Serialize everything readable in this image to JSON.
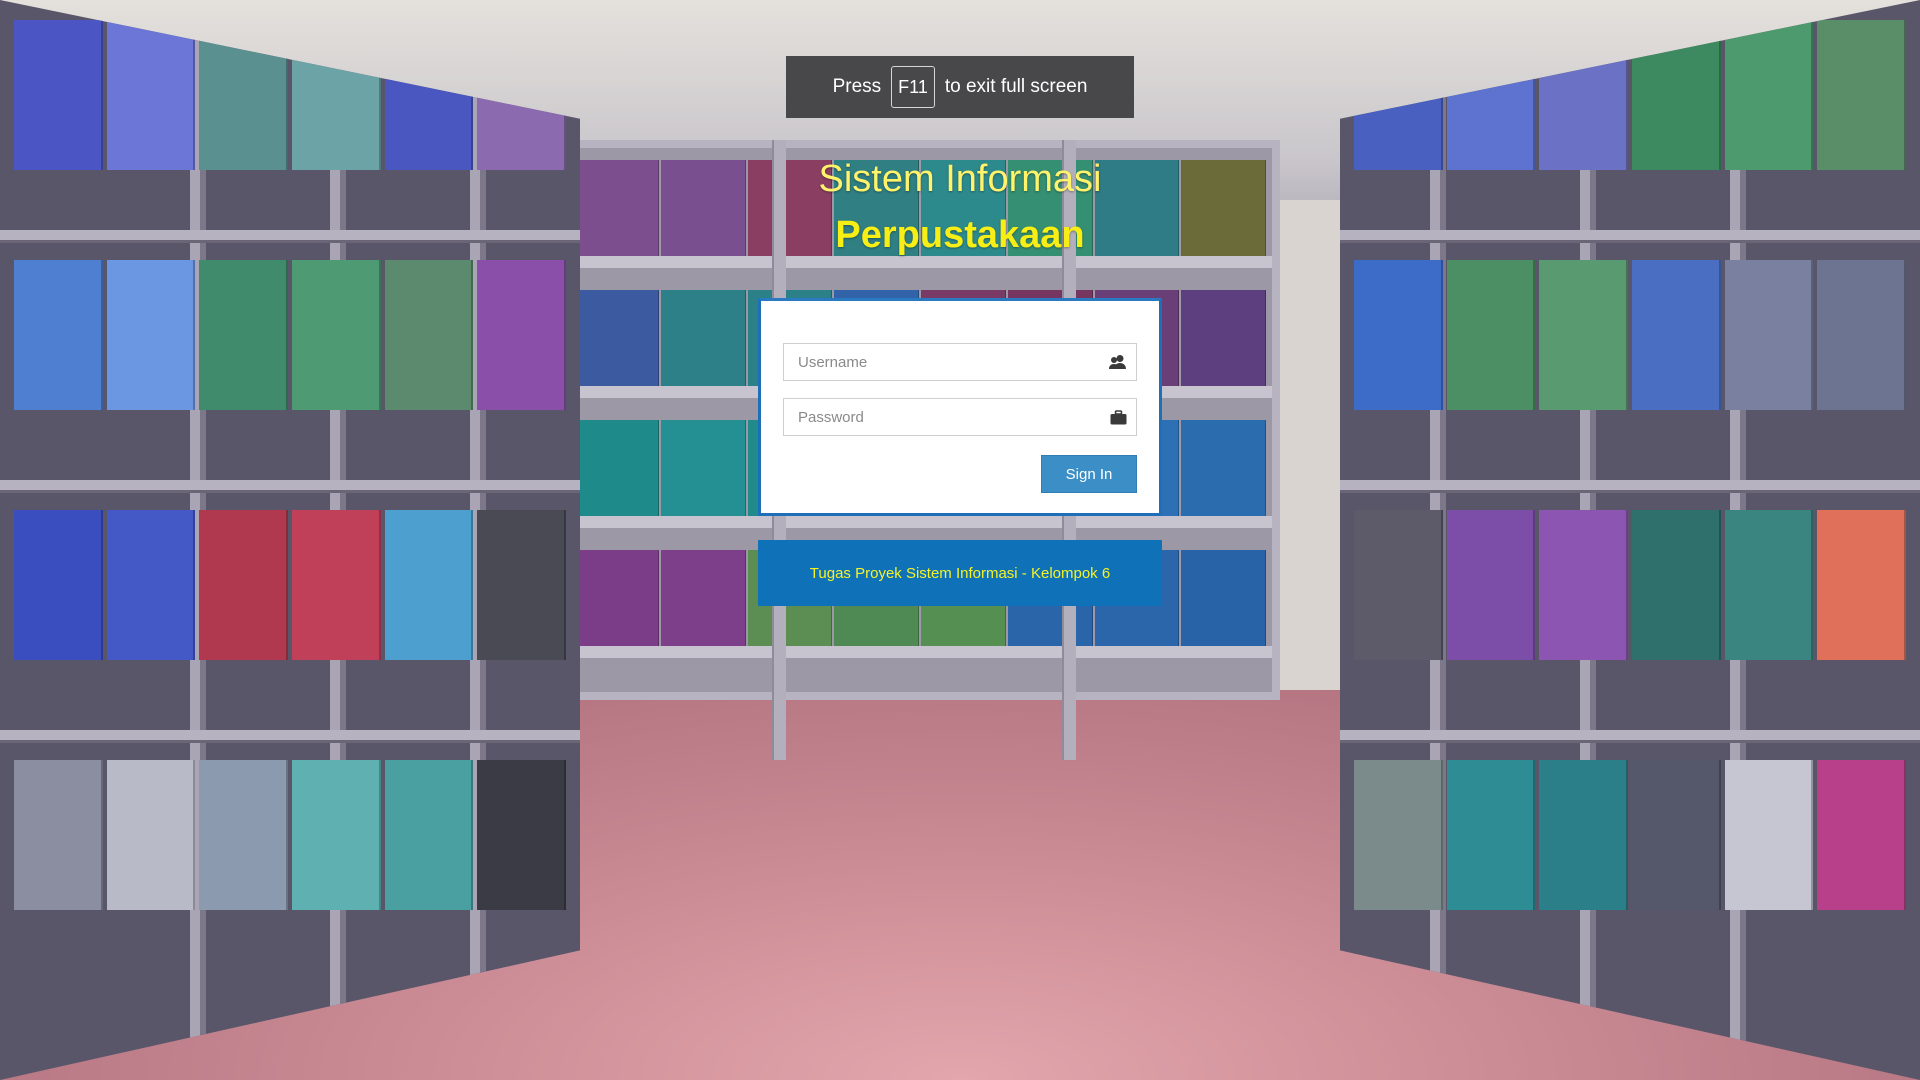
{
  "fullscreen_hint": {
    "prefix": "Press",
    "key": "F11",
    "suffix": "to exit full screen"
  },
  "title": {
    "line1": "Sistem Informasi",
    "line2": "Perpustakaan"
  },
  "login": {
    "username_placeholder": "Username",
    "password_placeholder": "Password",
    "username_icon": "users-icon",
    "password_icon": "briefcase-icon",
    "sign_in_label": "Sign In"
  },
  "footer": {
    "text": "Tugas Proyek Sistem Informasi - Kelompok 6"
  },
  "colors": {
    "title": "#f7ee16",
    "login_border": "#1e6fb8",
    "button": "#3b8ec6",
    "footer_bg": "#0f72b8",
    "footer_text": "#f5f225"
  }
}
